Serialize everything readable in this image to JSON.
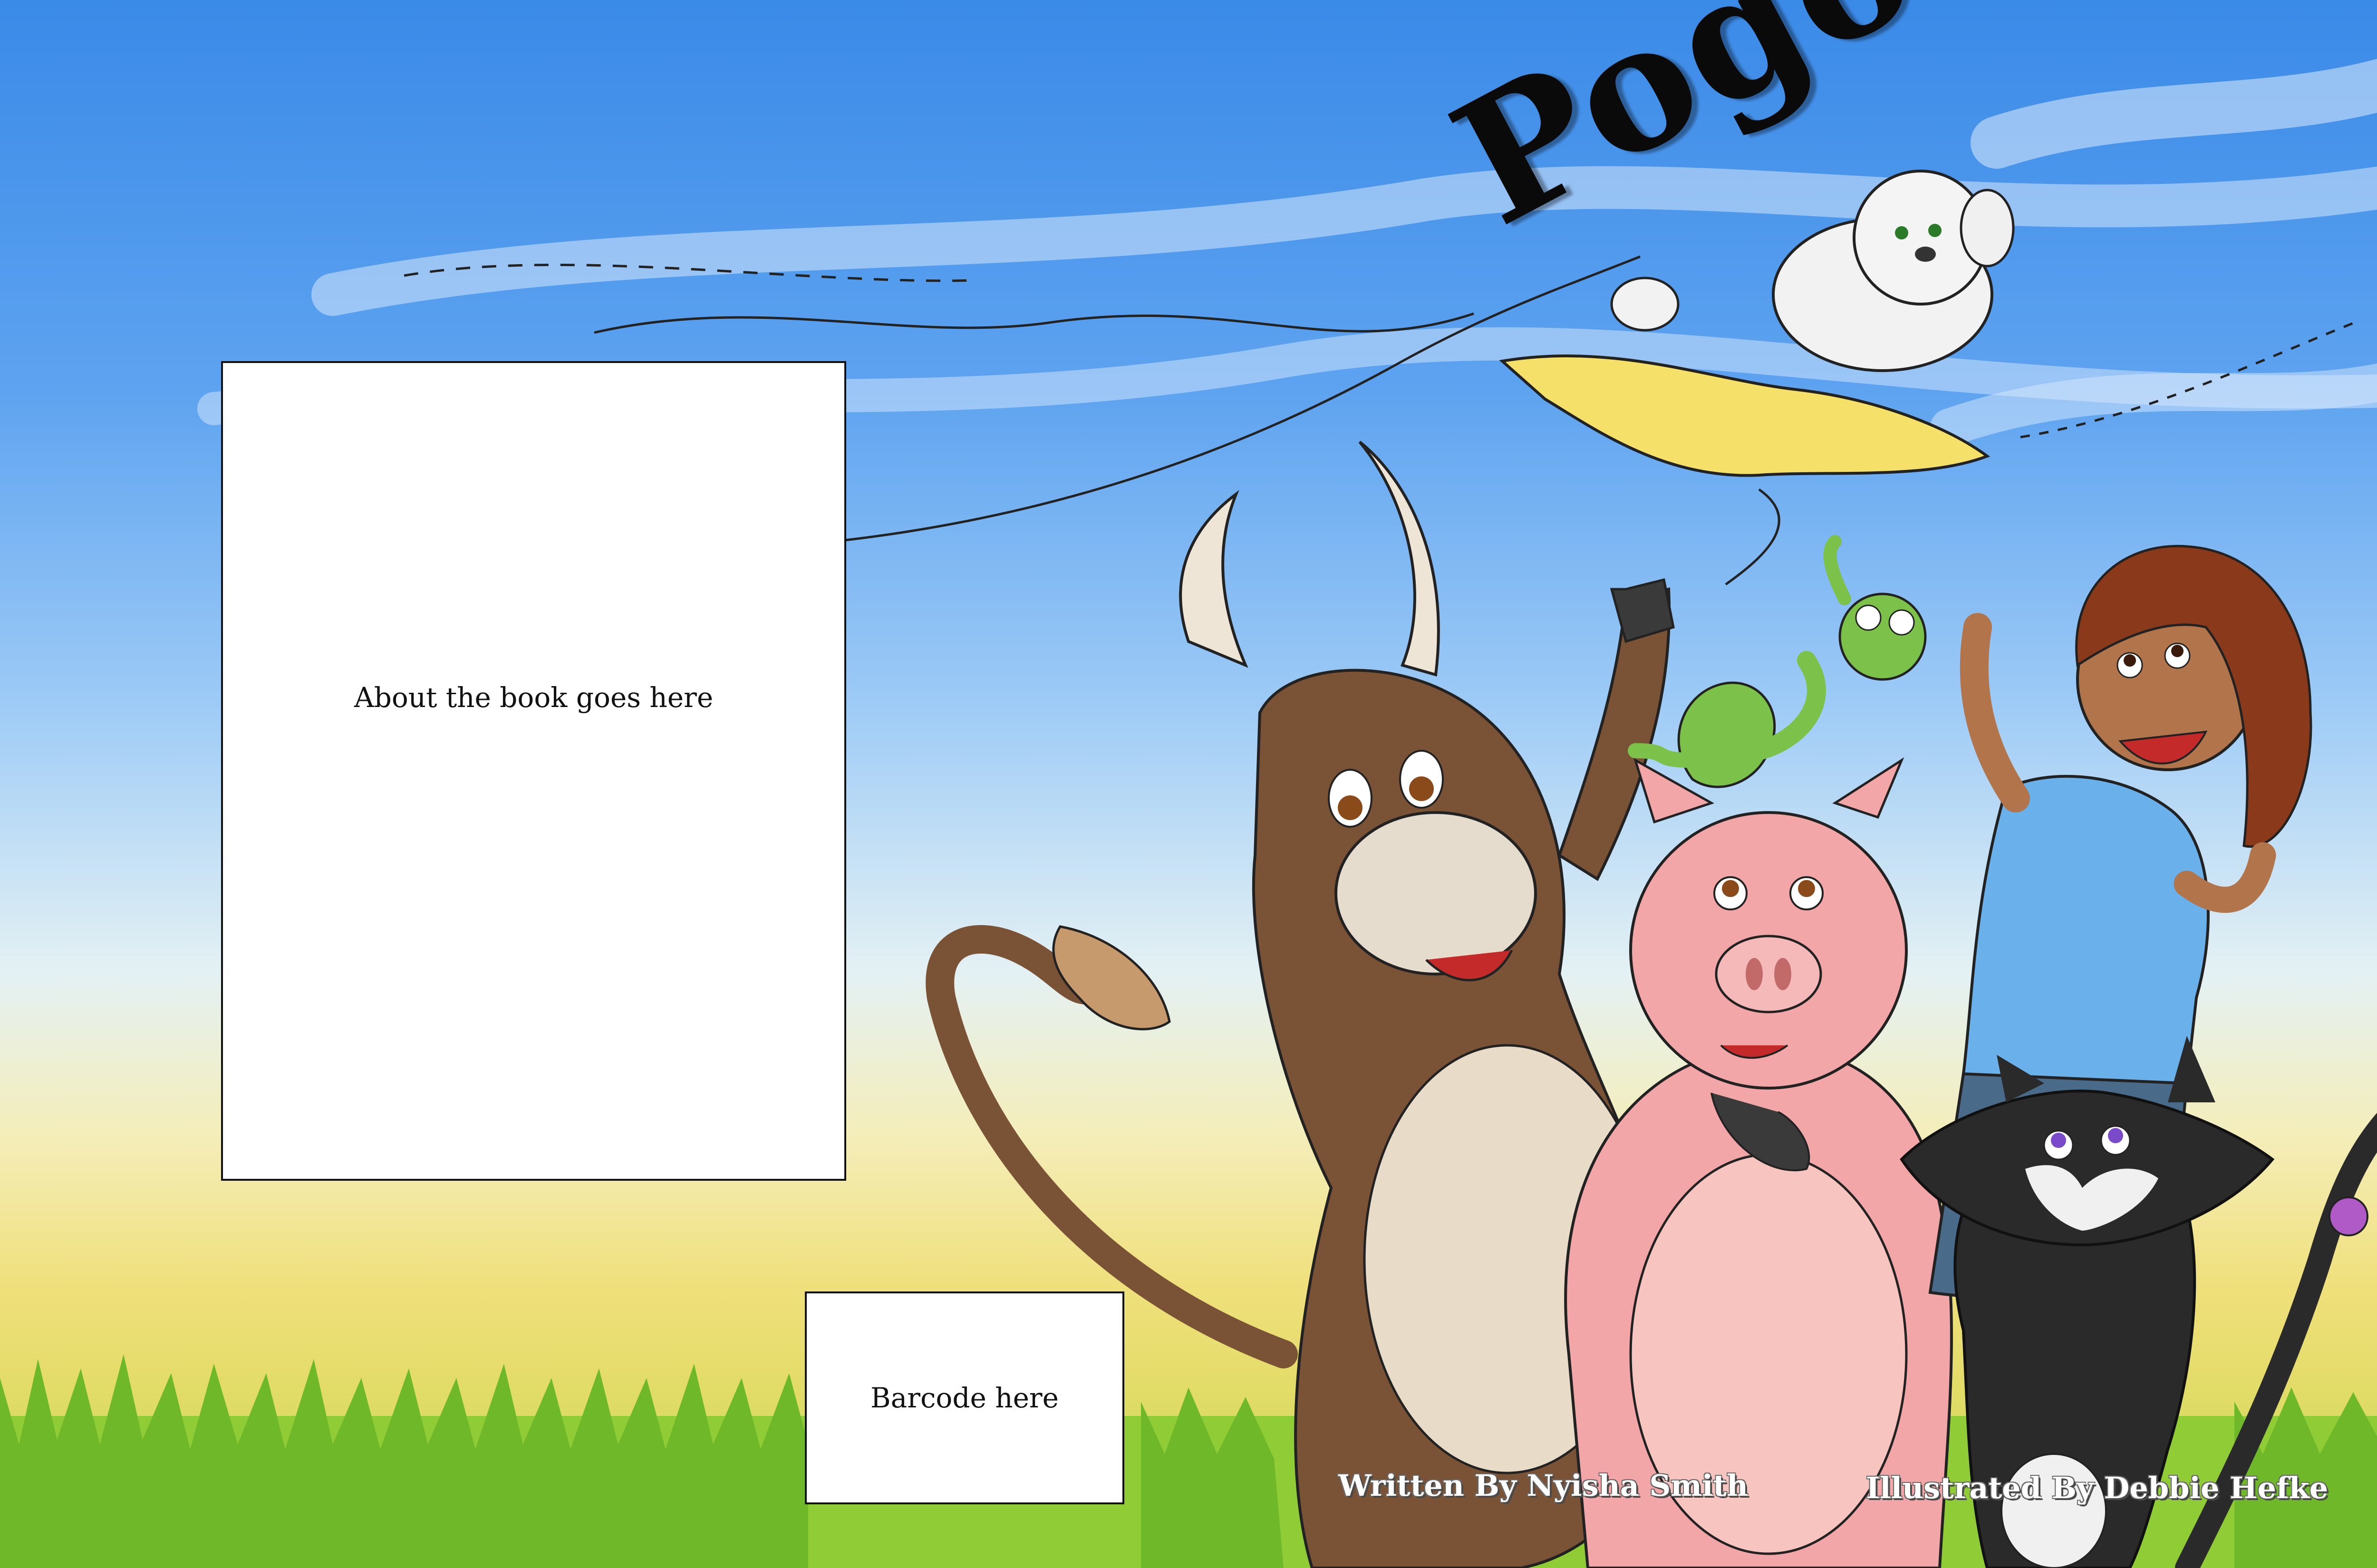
{
  "cover": {
    "title": "Pogo",
    "about_placeholder": "About the book goes here",
    "barcode_placeholder": "Barcode here",
    "author_credit": "Written By Nyisha Smith",
    "illustrator_credit": "Illustrated By Debbie Hefke"
  },
  "colors": {
    "sky_top": "#3a8ae8",
    "horizon": "#f0e07c",
    "grass": "#7cc22a",
    "bull_brown": "#7a5236",
    "pig_pink": "#f2a6a8",
    "frog_green": "#7cc24a",
    "cat_black": "#2a2a2a",
    "boy_shirt": "#6ab0ea",
    "kite_yellow": "#f5e06a"
  },
  "illustration": {
    "characters": [
      "dog-on-kite",
      "bull",
      "pig",
      "frog",
      "boy",
      "cat"
    ]
  }
}
